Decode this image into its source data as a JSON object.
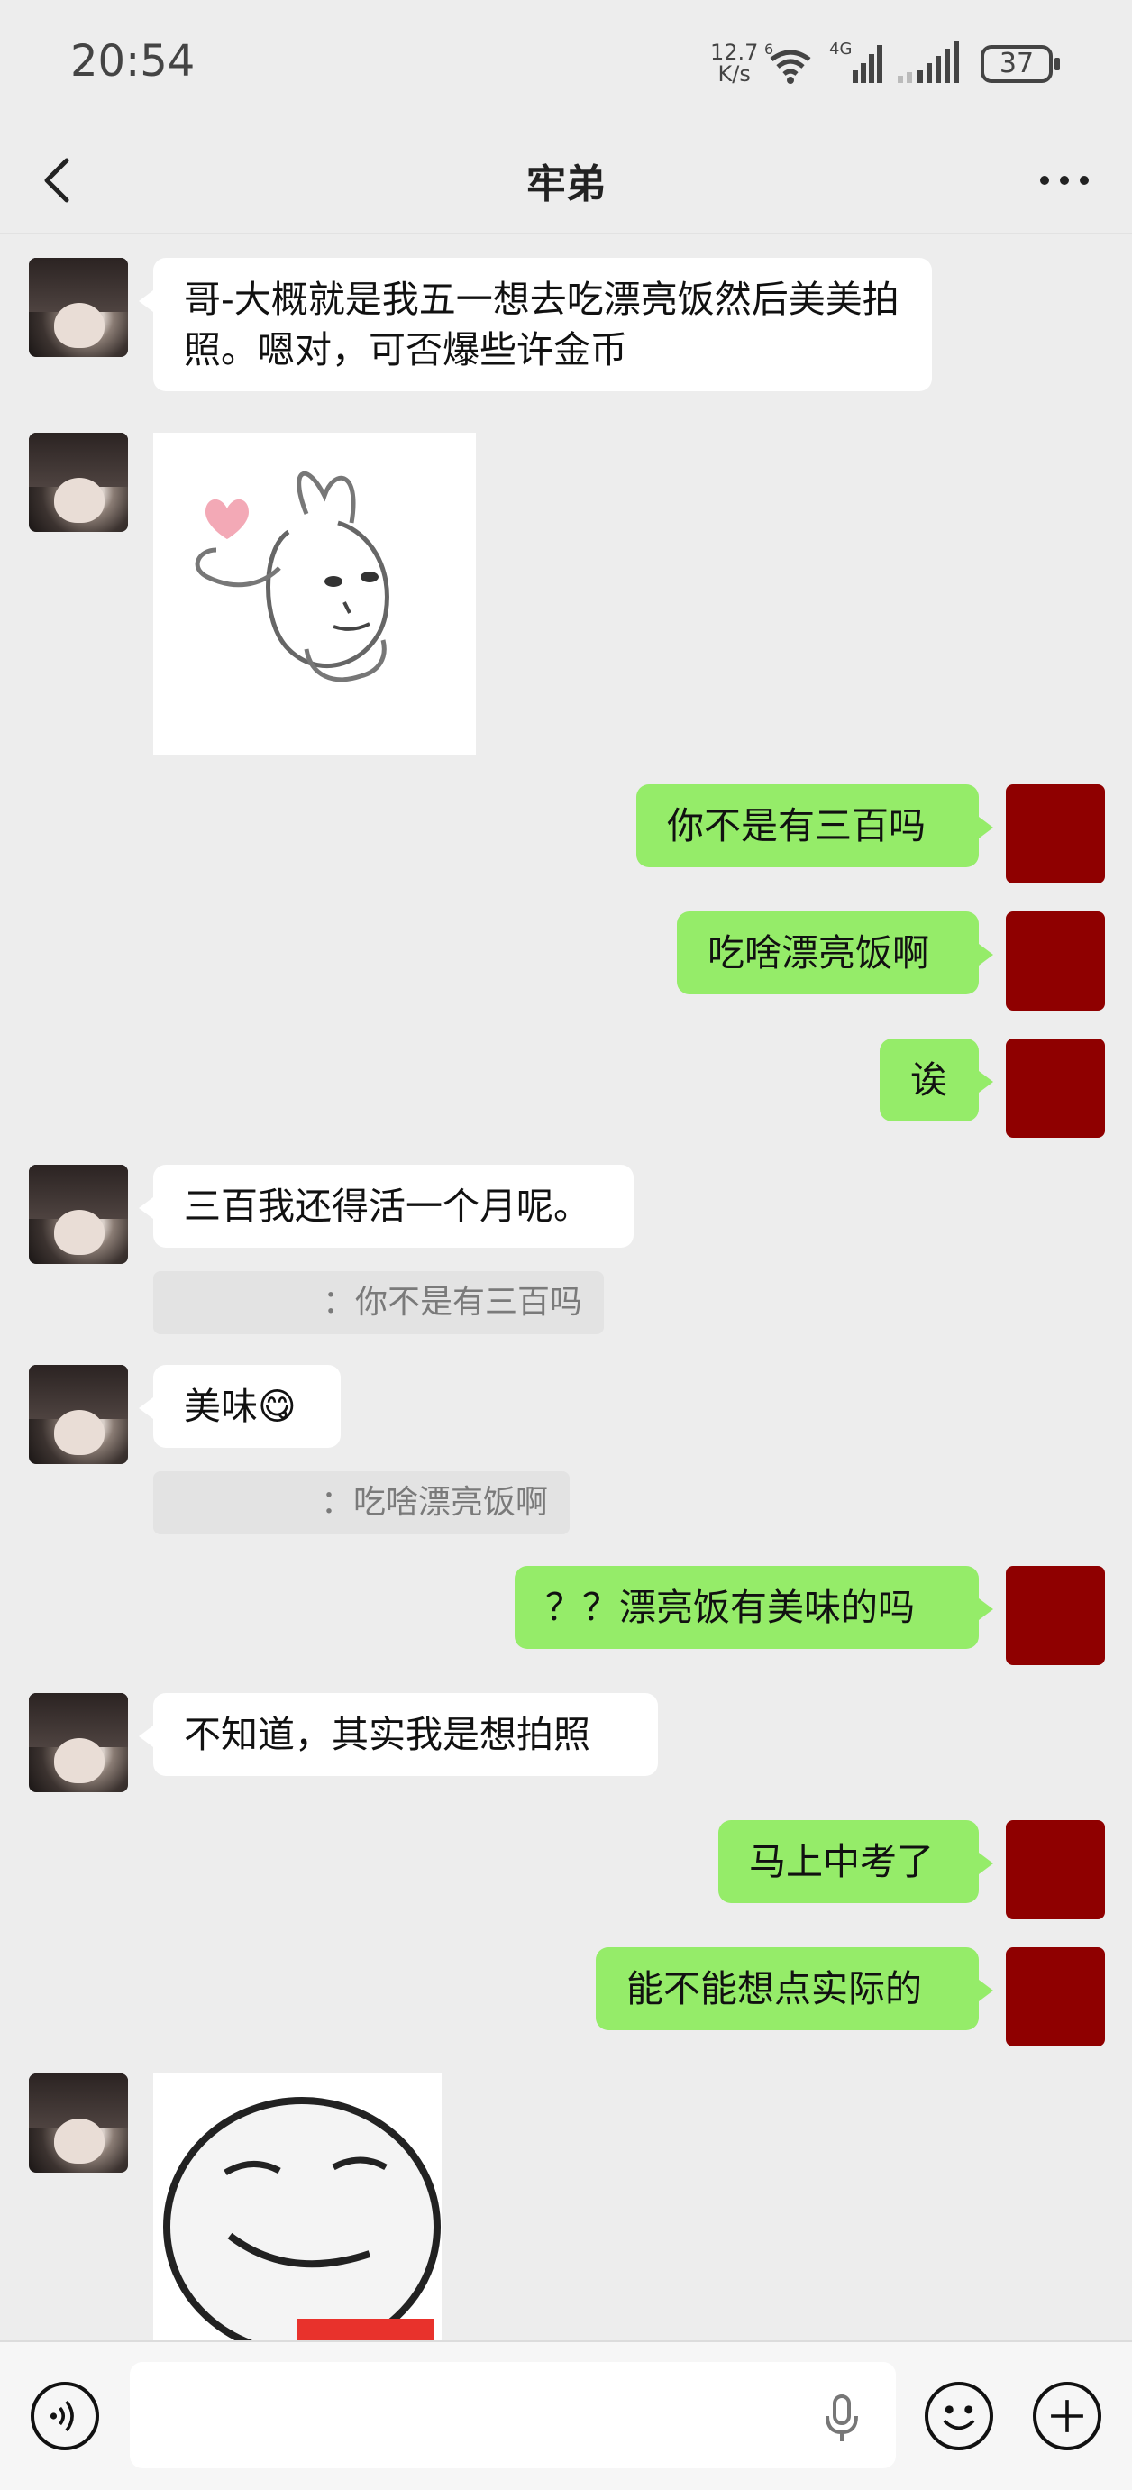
{
  "status_bar": {
    "time": "20:54",
    "speed": "12.7",
    "speed_unit": "K/s",
    "wifi_label": "6",
    "signal_label": "4G",
    "battery": "37"
  },
  "nav": {
    "title": "牢弟"
  },
  "messages": [
    {
      "side": "left",
      "text": "哥-大概就是我五一想去吃漂亮饭然后美美拍照。嗯对，可否爆些许金币"
    },
    {
      "side": "left",
      "type": "sticker",
      "icon": "bunny-heart-sticker"
    },
    {
      "side": "right",
      "text": "你不是有三百吗"
    },
    {
      "side": "right",
      "text": "吃啥漂亮饭啊"
    },
    {
      "side": "right",
      "text": "诶"
    },
    {
      "side": "left",
      "text": "三百我还得活一个月呢。",
      "quote": "：你不是有三百吗"
    },
    {
      "side": "left",
      "text": "美味😋",
      "quote": "：吃啥漂亮饭啊"
    },
    {
      "side": "right",
      "text": "？？漂亮饭有美味的吗"
    },
    {
      "side": "left",
      "text": "不知道，其实我是想拍照"
    },
    {
      "side": "right",
      "text": "马上中考了"
    },
    {
      "side": "right",
      "text": "能不能想点实际的"
    },
    {
      "side": "left",
      "type": "sticker",
      "icon": "smirk-face-sticker"
    }
  ],
  "input_bar": {
    "voice_icon": "voice-icon",
    "mic_icon": "mic-icon",
    "emoji_icon": "emoji-icon",
    "plus_icon": "plus-icon"
  },
  "colors": {
    "bubble_self": "#95ec69",
    "bubble_other": "#ffffff",
    "background": "#ededed"
  }
}
